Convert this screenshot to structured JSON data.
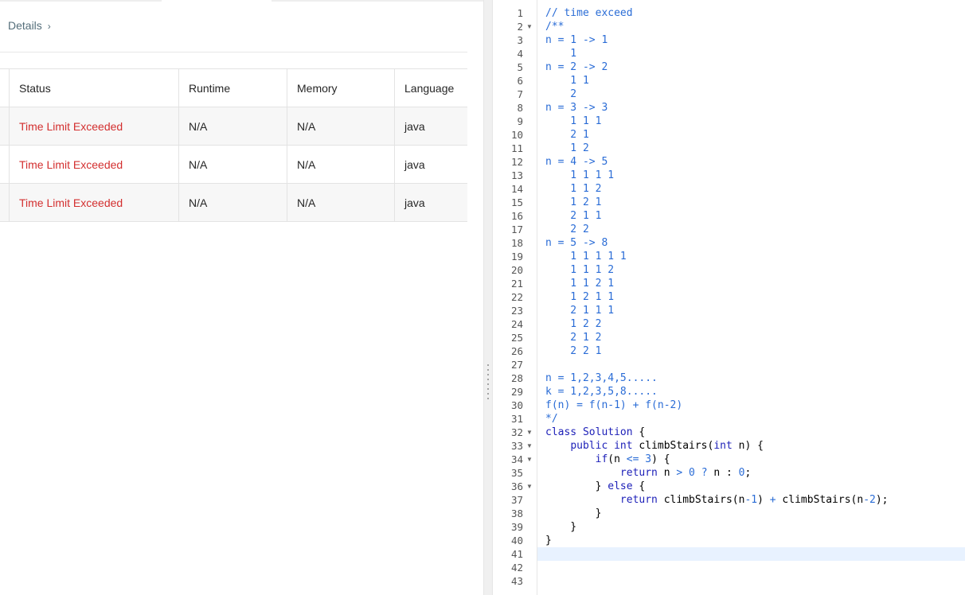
{
  "details": {
    "label": "Details",
    "chevron_icon": "chevron-right-icon"
  },
  "table": {
    "headers": [
      "Status",
      "Runtime",
      "Memory",
      "Language"
    ],
    "rows": [
      {
        "status": "Time Limit Exceeded",
        "runtime": "N/A",
        "memory": "N/A",
        "language": "java"
      },
      {
        "status": "Time Limit Exceeded",
        "runtime": "N/A",
        "memory": "N/A",
        "language": "java"
      },
      {
        "status": "Time Limit Exceeded",
        "runtime": "N/A",
        "memory": "N/A",
        "language": "java"
      }
    ]
  },
  "editor": {
    "active_line": 41,
    "folds": [
      2,
      32,
      33,
      34,
      36
    ],
    "line_numbers": [
      "1",
      "2",
      "3",
      "4",
      "5",
      "6",
      "7",
      "8",
      "9",
      "10",
      "11",
      "12",
      "13",
      "14",
      "15",
      "16",
      "17",
      "18",
      "19",
      "20",
      "21",
      "22",
      "23",
      "24",
      "25",
      "26",
      "27",
      "28",
      "29",
      "30",
      "31",
      "32",
      "33",
      "34",
      "35",
      "36",
      "37",
      "38",
      "39",
      "40",
      "41",
      "42",
      "43"
    ],
    "lines": [
      [
        [
          "// time exceed",
          "comment"
        ]
      ],
      [
        [
          "/**",
          "comment"
        ]
      ],
      [
        [
          "n = 1 -> 1",
          "comment"
        ]
      ],
      [
        [
          "    1",
          "comment"
        ]
      ],
      [
        [
          "n = 2 -> 2",
          "comment"
        ]
      ],
      [
        [
          "    1 1",
          "comment"
        ]
      ],
      [
        [
          "    2",
          "comment"
        ]
      ],
      [
        [
          "n = 3 -> 3",
          "comment"
        ]
      ],
      [
        [
          "    1 1 1",
          "comment"
        ]
      ],
      [
        [
          "    2 1",
          "comment"
        ]
      ],
      [
        [
          "    1 2",
          "comment"
        ]
      ],
      [
        [
          "n = 4 -> 5",
          "comment"
        ]
      ],
      [
        [
          "    1 1 1 1",
          "comment"
        ]
      ],
      [
        [
          "    1 1 2",
          "comment"
        ]
      ],
      [
        [
          "    1 2 1",
          "comment"
        ]
      ],
      [
        [
          "    2 1 1",
          "comment"
        ]
      ],
      [
        [
          "    2 2",
          "comment"
        ]
      ],
      [
        [
          "n = 5 -> 8",
          "comment"
        ]
      ],
      [
        [
          "    1 1 1 1 1",
          "comment"
        ]
      ],
      [
        [
          "    1 1 1 2",
          "comment"
        ]
      ],
      [
        [
          "    1 1 2 1",
          "comment"
        ]
      ],
      [
        [
          "    1 2 1 1",
          "comment"
        ]
      ],
      [
        [
          "    2 1 1 1",
          "comment"
        ]
      ],
      [
        [
          "    1 2 2",
          "comment"
        ]
      ],
      [
        [
          "    2 1 2",
          "comment"
        ]
      ],
      [
        [
          "    2 2 1",
          "comment"
        ]
      ],
      [],
      [
        [
          "n = 1,2,3,4,5.....",
          "comment"
        ]
      ],
      [
        [
          "k = 1,2,3,5,8.....",
          "comment"
        ]
      ],
      [
        [
          "f(n) = f(n-1) + f(n-2)",
          "comment"
        ]
      ],
      [
        [
          "*/",
          "comment"
        ]
      ],
      [
        [
          "class",
          "kw"
        ],
        [
          " ",
          "plain"
        ],
        [
          "Solution",
          "type"
        ],
        [
          " {",
          "plain"
        ]
      ],
      [
        [
          "    ",
          "plain"
        ],
        [
          "public",
          "kw"
        ],
        [
          " ",
          "plain"
        ],
        [
          "int",
          "type"
        ],
        [
          " climbStairs(",
          "plain"
        ],
        [
          "int",
          "type"
        ],
        [
          " n) {",
          "plain"
        ]
      ],
      [
        [
          "        ",
          "plain"
        ],
        [
          "if",
          "kw"
        ],
        [
          "(n ",
          "plain"
        ],
        [
          "<=",
          "op"
        ],
        [
          " ",
          "plain"
        ],
        [
          "3",
          "num"
        ],
        [
          ") {",
          "plain"
        ]
      ],
      [
        [
          "            ",
          "plain"
        ],
        [
          "return",
          "kw"
        ],
        [
          " n ",
          "plain"
        ],
        [
          ">",
          "op"
        ],
        [
          " ",
          "plain"
        ],
        [
          "0",
          "num"
        ],
        [
          " ",
          "plain"
        ],
        [
          "?",
          "op"
        ],
        [
          " n : ",
          "plain"
        ],
        [
          "0",
          "num"
        ],
        [
          ";",
          "plain"
        ]
      ],
      [
        [
          "        } ",
          "plain"
        ],
        [
          "else",
          "kw"
        ],
        [
          " {",
          "plain"
        ]
      ],
      [
        [
          "            ",
          "plain"
        ],
        [
          "return",
          "kw"
        ],
        [
          " climbStairs(n",
          "plain"
        ],
        [
          "-",
          "op"
        ],
        [
          "1",
          "num"
        ],
        [
          ") ",
          "plain"
        ],
        [
          "+",
          "op"
        ],
        [
          " climbStairs(n",
          "plain"
        ],
        [
          "-",
          "op"
        ],
        [
          "2",
          "num"
        ],
        [
          ");",
          "plain"
        ]
      ],
      [
        [
          "        }",
          "plain"
        ]
      ],
      [
        [
          "    }",
          "plain"
        ]
      ],
      [
        [
          "}",
          "plain"
        ]
      ],
      [],
      [],
      []
    ]
  }
}
